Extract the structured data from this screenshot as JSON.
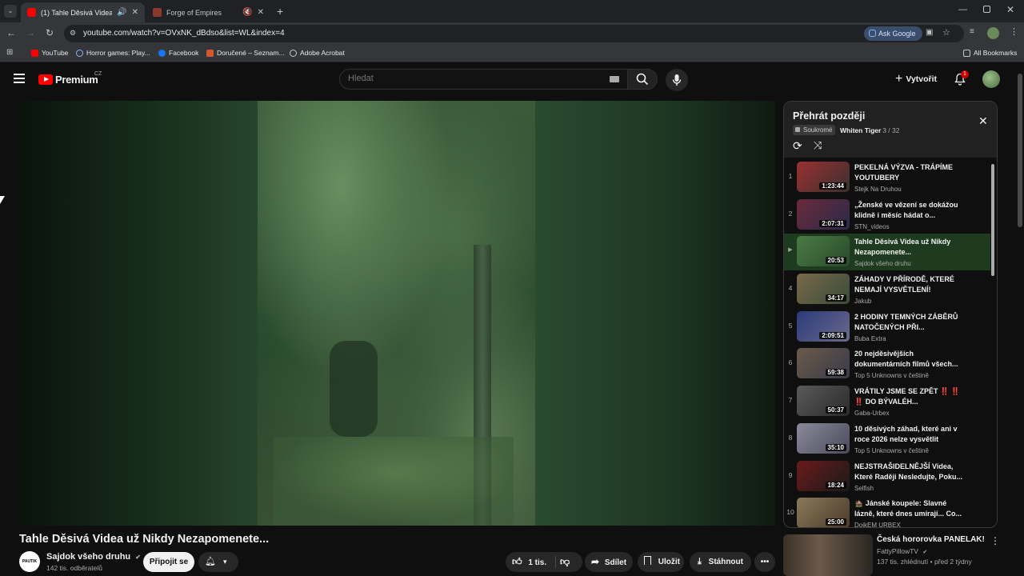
{
  "browser": {
    "tabs": [
      {
        "title": "(1) Tahle Děsivá Videa už N",
        "active": true
      },
      {
        "title": "Forge of Empires",
        "active": false
      }
    ],
    "url": "youtube.com/watch?v=OVxNK_dBdso&list=WL&index=4",
    "ask_google": "Ask Google",
    "bookmarks": [
      "YouTube",
      "Horror games: Play...",
      "Facebook",
      "Doručené – Seznam...",
      "Adobe Acrobat"
    ],
    "all_bookmarks": "All Bookmarks"
  },
  "youtube": {
    "logo": "Premium",
    "region": "CZ",
    "search_placeholder": "Hledat",
    "create_label": "Vytvořit",
    "notification_count": "1"
  },
  "video": {
    "title": "Tahle Děsivá Videa už Nikdy Nezapomenete...",
    "channel": "Sajdok všeho druhu",
    "subscribers": "142 tis. odběratelů",
    "avatar_text": "PAUTIK",
    "subscribe_label": "Připojit se",
    "likes": "1 tis.",
    "share_label": "Sdílet",
    "save_label": "Uložit",
    "download_label": "Stáhnout"
  },
  "playlist": {
    "title": "Přehrát později",
    "privacy": "Soukromé",
    "owner": "Whiten Tiger",
    "position": "- 3 / 32",
    "items": [
      {
        "index": "1",
        "title": "PEKELNÁ VÝZVA - TRÁPÍME YOUTUBERY",
        "channel": "Stejk Na Druhou",
        "duration": "1:23:44",
        "color": "#8a2a2a"
      },
      {
        "index": "2",
        "title": "„Ženské ve vězení se dokážou klidně i měsíc hádat o...",
        "channel": "STN_videos",
        "duration": "2:07:31",
        "color": "#5a2f3a"
      },
      {
        "index": "▶",
        "title": "Tahle Děsivá Videa už Nikdy Nezapomenete...",
        "channel": "Sajdok všeho druhu",
        "duration": "20:53",
        "color": "#3f6a3a"
      },
      {
        "index": "4",
        "title": "ZÁHADY V PŘÍRODĚ, KTERÉ NEMAJÍ VYSVĚTLENÍ!",
        "channel": "Jakub",
        "duration": "34:17",
        "color": "#6a5a3a"
      },
      {
        "index": "5",
        "title": "2 HODINY TEMNÝCH ZÁBĚRŮ NATOČENÝCH PŘI...",
        "channel": "Buba Extra",
        "duration": "2:09:51",
        "color": "#2a3a6a"
      },
      {
        "index": "6",
        "title": "20 nejděsivějších dokumentárních filmů všech...",
        "channel": "Top 5 Unknowns v češtině",
        "duration": "59:38",
        "color": "#5a4a3a"
      },
      {
        "index": "7",
        "title": "VRÁTILY JSME SE ZPĚT ‼️ ‼️ ‼️ DO BÝVALÉH...",
        "channel": "Gaba-Urbex",
        "duration": "50:37",
        "color": "#4a4a4a"
      },
      {
        "index": "8",
        "title": "10 děsivých záhad, které ani v roce 2026 nelze vysvětlit",
        "channel": "Top 5 Unknowns v češtině",
        "duration": "35:10",
        "color": "#6a6a7a"
      },
      {
        "index": "9",
        "title": "NEJSTRAŠIDELNĚJŠÍ Videa, Které Raději Nesledujte, Poku...",
        "channel": "Selfish",
        "duration": "18:24",
        "color": "#5a1a1a"
      },
      {
        "index": "10",
        "title": "🏚️ Jánské koupele: Slavné lázně, které dnes umírají... Co...",
        "channel": "DojkEM URBEX",
        "duration": "25:00",
        "color": "#7a6a4a"
      }
    ]
  },
  "recommendation": {
    "title": "Česká hororovka PANELAK!",
    "channel": "FattyPillowTV",
    "meta": "137 tis. zhlédnutí • před 2 týdny"
  }
}
